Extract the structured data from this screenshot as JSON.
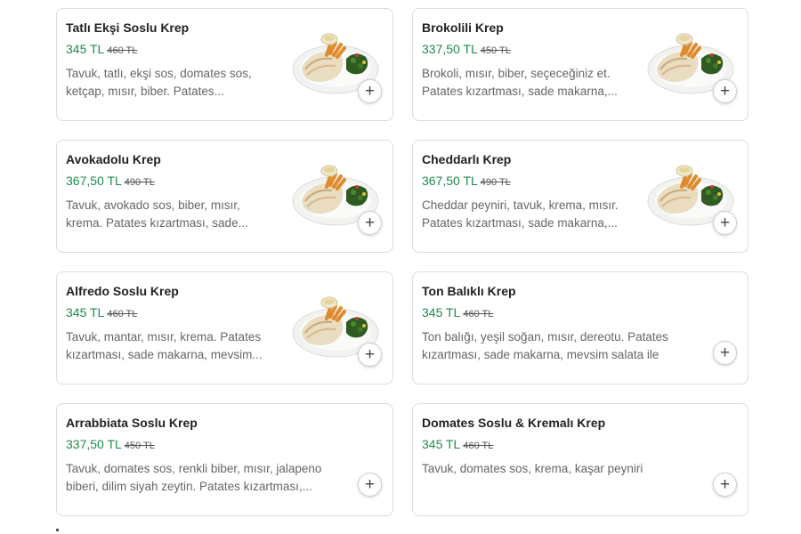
{
  "menu": {
    "items": [
      {
        "name": "Tatlı Ekşi Soslu Krep",
        "price": "345 TL",
        "old_price": "460 TL",
        "description": "Tavuk, tatlı, ekşi sos, domates sos, ketçap, mısır, biber. Patates...",
        "has_image": true,
        "add_icon": "plus-icon"
      },
      {
        "name": "Brokolili Krep",
        "price": "337,50 TL",
        "old_price": "450 TL",
        "description": "Brokoli, mısır, biber, seçeceğiniz et. Patates kızartması, sade makarna,...",
        "has_image": true,
        "add_icon": "plus-icon"
      },
      {
        "name": "Avokadolu Krep",
        "price": "367,50 TL",
        "old_price": "490 TL",
        "description": "Tavuk, avokado sos, biber, mısır, krema. Patates kızartması, sade...",
        "has_image": true,
        "add_icon": "plus-icon"
      },
      {
        "name": "Cheddarlı Krep",
        "price": "367,50 TL",
        "old_price": "490 TL",
        "description": "Cheddar peyniri, tavuk, krema, mısır. Patates kızartması, sade makarna,...",
        "has_image": true,
        "add_icon": "plus-icon"
      },
      {
        "name": "Alfredo Soslu Krep",
        "price": "345 TL",
        "old_price": "460 TL",
        "description": "Tavuk, mantar, mısır, krema. Patates kızartması, sade makarna, mevsim...",
        "has_image": true,
        "add_icon": "plus-icon"
      },
      {
        "name": "Ton Balıklı Krep",
        "price": "345 TL",
        "old_price": "460 TL",
        "description": "Ton balığı, yeşil soğan, mısır, dereotu. Patates kızartması, sade makarna, mevsim salata ile",
        "has_image": false,
        "add_icon": "plus-icon"
      },
      {
        "name": "Arrabbiata Soslu Krep",
        "price": "337,50 TL",
        "old_price": "450 TL",
        "description": "Tavuk, domates sos, renkli biber, mısır, jalapeno biberi, dilim siyah zeytin. Patates kızartması,...",
        "has_image": false,
        "add_icon": "plus-icon"
      },
      {
        "name": "Domates Soslu & Kremalı Krep",
        "price": "345 TL",
        "old_price": "460 TL",
        "description": "Tavuk, domates sos, krema, kaşar peyniri",
        "has_image": false,
        "add_icon": "plus-icon"
      }
    ],
    "add_symbol": "+"
  },
  "colors": {
    "price_green": "#1f8a4c",
    "card_border": "#dcdcdc",
    "description_gray": "#666666"
  }
}
